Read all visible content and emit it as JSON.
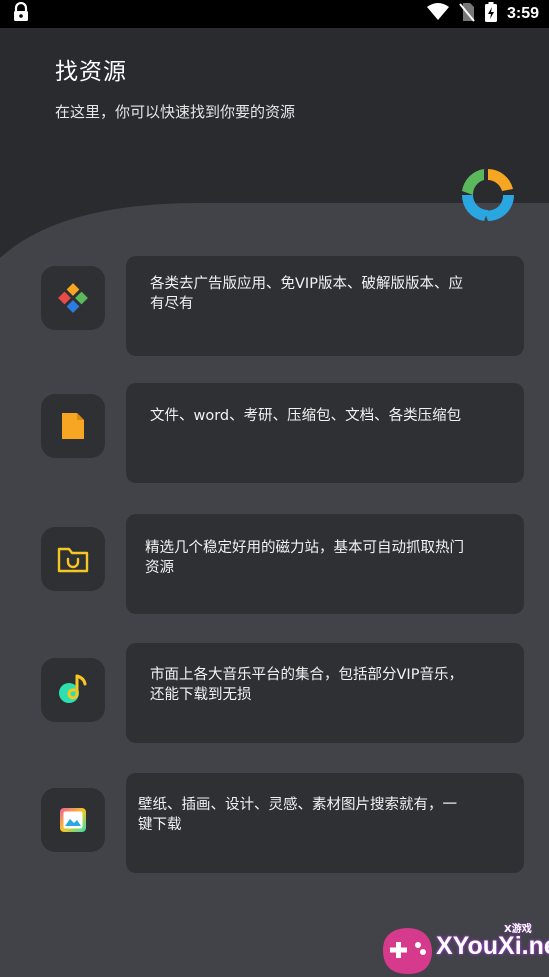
{
  "status_bar": {
    "time": "3:59",
    "icons": [
      "lock-icon",
      "wifi-icon",
      "no-sim-icon",
      "battery-charging-icon"
    ]
  },
  "header": {
    "title": "找资源",
    "subtitle": "在这里，你可以快速找到你要的资源"
  },
  "features": [
    {
      "icon": "apps-icon",
      "text_line1": "各类去广告版应用、免VIP版本、破解版版本、应",
      "text_line2": "有尽有"
    },
    {
      "icon": "document-icon",
      "text_line1": "文件、word、考研、压缩包、文档、各类压缩包",
      "text_line2": ""
    },
    {
      "icon": "magnet-folder-icon",
      "text_line1": "精选几个稳定好用的磁力站，基本可自动抓取热门",
      "text_line2": "资源"
    },
    {
      "icon": "music-note-icon",
      "text_line1": "市面上各大音乐平台的集合，包括部分VIP音乐，",
      "text_line2": "还能下载到无损"
    },
    {
      "icon": "image-icon",
      "text_line1": "壁纸、插画、设计、灵感、素材图片搜索就有，一",
      "text_line2": "键下载"
    }
  ],
  "watermark": {
    "brand": "XYouXi.net",
    "tag": "X游戏"
  },
  "colors": {
    "background": "#2b2c30",
    "panel": "#424348",
    "card": "#2f3034",
    "accent_orange": "#f6a623",
    "accent_blue": "#2aa6e0",
    "accent_green": "#5cb85c"
  }
}
